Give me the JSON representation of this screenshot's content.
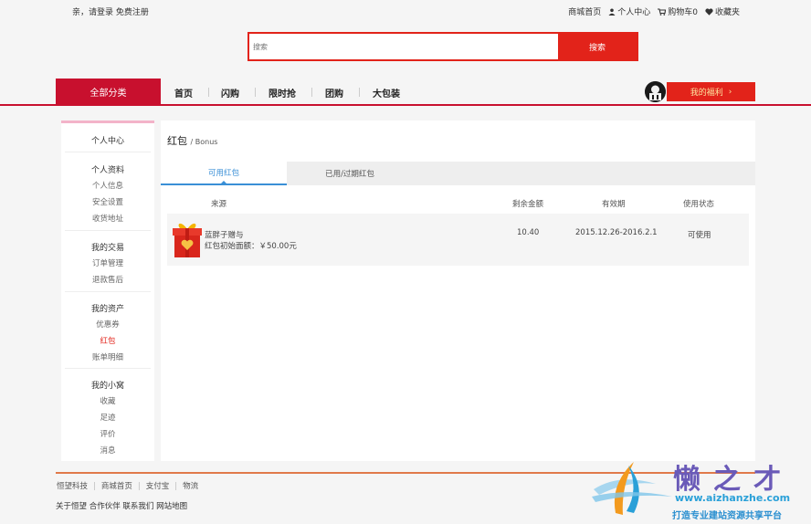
{
  "topbar": {
    "greeting": "亲，请登录",
    "register": "免费注册",
    "links": [
      "商城首页",
      "个人中心",
      "购物车0",
      "收藏夹"
    ]
  },
  "search": {
    "placeholder": "搜索",
    "button": "搜索"
  },
  "nav": {
    "all_categories": "全部分类",
    "items": [
      "首页",
      "闪购",
      "限时抢",
      "团购",
      "大包装"
    ],
    "welfare": "我的福利",
    "welfare_arrow": "›"
  },
  "sidebar": {
    "title": "个人中心",
    "groups": [
      {
        "heading": "个人资料",
        "items": [
          "个人信息",
          "安全设置",
          "收货地址"
        ]
      },
      {
        "heading": "我的交易",
        "items": [
          "订单管理",
          "退款售后"
        ]
      },
      {
        "heading": "我的资产",
        "items": [
          "优惠券",
          "红包",
          "账单明细"
        ]
      },
      {
        "heading": "我的小窝",
        "items": [
          "收藏",
          "足迹",
          "评价",
          "消息"
        ]
      }
    ]
  },
  "page": {
    "title": "红包",
    "subtitle": "/ Bonus"
  },
  "tabs": [
    "可用红包",
    "已用/过期红包"
  ],
  "table": {
    "headers": [
      "来源",
      "剩余金额",
      "有效期",
      "使用状态"
    ],
    "rows": [
      {
        "source_line1": "蓝胖子赠与",
        "source_line2": "红包初始面额：￥50.00元",
        "remaining": "10.40",
        "validity": "2015.12.26-2016.2.1",
        "status": "可使用"
      }
    ]
  },
  "footer": {
    "links": [
      "恒望科技",
      "商城首页",
      "支付宝",
      "物流"
    ],
    "line2": "关于恒望 合作伙伴 联系我们 网站地图"
  },
  "watermark": {
    "brand": "懒之才",
    "url": "www.aizhanzhe.com",
    "slogan": "打造专业建站资源共享平台"
  },
  "colors": {
    "accent": "#e2231a",
    "nav_red": "#c8102e",
    "tab_blue": "#3a8fd6"
  }
}
